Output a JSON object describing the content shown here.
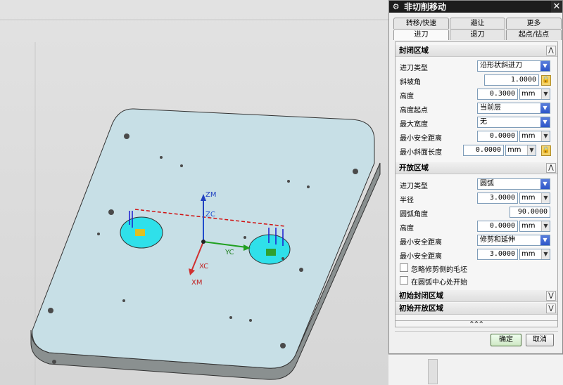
{
  "viewport": {
    "axes": {
      "zm": "ZM",
      "zc": "ZC",
      "yc": "YC",
      "xc": "XC",
      "xm": "XM"
    }
  },
  "dialog": {
    "title": "非切削移动",
    "tabs_top": [
      "转移/快速",
      "避让",
      "更多"
    ],
    "tabs_bottom": [
      "进刀",
      "退刀",
      "起点/钻点"
    ],
    "active_tab": "进刀",
    "closed_area": {
      "header": "封闭区域",
      "rows": {
        "engage_type": {
          "label": "进刀类型",
          "value": "沿形状斜进刀"
        },
        "ramp_angle": {
          "label": "斜坡角",
          "value": "1.0000"
        },
        "height": {
          "label": "高度",
          "value": "0.3000",
          "unit": "mm"
        },
        "height_from": {
          "label": "高度起点",
          "value": "当前层"
        },
        "max_width": {
          "label": "最大宽度",
          "value": "无"
        },
        "min_safe": {
          "label": "最小安全距离",
          "value": "0.0000",
          "unit": "mm"
        },
        "min_ramp_len": {
          "label": "最小斜面长度",
          "value": "0.0000",
          "unit": "mm"
        }
      }
    },
    "open_area": {
      "header": "开放区域",
      "rows": {
        "engage_type": {
          "label": "进刀类型",
          "value": "圆弧"
        },
        "radius": {
          "label": "半径",
          "value": "3.0000",
          "unit": "mm"
        },
        "arc_angle": {
          "label": "圆弧角度",
          "value": "90.0000"
        },
        "height": {
          "label": "高度",
          "value": "0.0000",
          "unit": "mm"
        },
        "min_safe_1": {
          "label": "最小安全距离",
          "value": "修剪和延伸"
        },
        "min_safe_2": {
          "label": "最小安全距离",
          "value": "3.0000",
          "unit": "mm"
        }
      },
      "checkboxes": [
        {
          "label": "忽略修剪侧的毛坯",
          "checked": false
        },
        {
          "label": "在圆弧中心处开始",
          "checked": false
        }
      ]
    },
    "initial_closed": "初始封闭区域",
    "initial_open": "初始开放区域",
    "collapse": "^^^",
    "ok": "确定",
    "cancel": "取消"
  }
}
